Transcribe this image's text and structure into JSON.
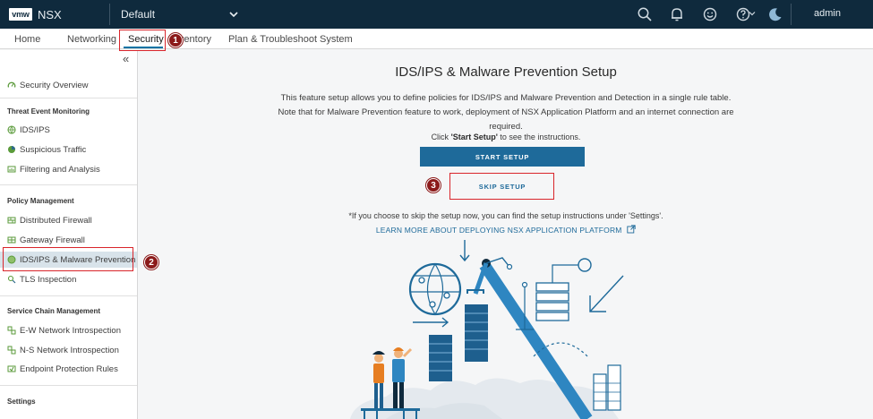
{
  "header": {
    "logo": "vmw",
    "app_name": "NSX",
    "project": "Default",
    "user": "admin"
  },
  "nav": {
    "items": [
      "Home",
      "Networking",
      "Security",
      "Inventory",
      "Plan & Troubleshoot",
      "System"
    ],
    "active": "Security"
  },
  "sidebar": {
    "collapse_glyph": "«",
    "overview": "Security Overview",
    "sections": [
      {
        "title": "Threat Event Monitoring",
        "items": [
          "IDS/IPS",
          "Suspicious Traffic",
          "Filtering and Analysis"
        ]
      },
      {
        "title": "Policy Management",
        "items": [
          "Distributed Firewall",
          "Gateway Firewall",
          "IDS/IPS & Malware Prevention",
          "TLS Inspection"
        ]
      },
      {
        "title": "Service Chain Management",
        "items": [
          "E-W Network Introspection",
          "N-S Network Introspection",
          "Endpoint Protection Rules"
        ]
      },
      {
        "title": "Settings",
        "items": []
      }
    ],
    "active_item": "IDS/IPS & Malware Prevention"
  },
  "main": {
    "title": "IDS/IPS & Malware Prevention Setup",
    "description": "This feature setup allows you to define policies for IDS/IPS and Malware Prevention and Detection in a single rule table. Note that for Malware Prevention feature to work, deployment of NSX Application Platform and an internet connection are required.",
    "instruction_prefix": "Click ",
    "instruction_bold": "'Start Setup'",
    "instruction_suffix": " to see the instructions.",
    "start_button": "START SETUP",
    "skip_button": "SKIP SETUP",
    "skip_note": "*If you choose to skip the setup now, you can find the setup instructions under 'Settings'.",
    "learn_link": "LEARN MORE ABOUT DEPLOYING NSX APPLICATION PLATFORM"
  },
  "callouts": [
    "1",
    "2",
    "3"
  ],
  "colors": {
    "header_bg": "#0f2a3d",
    "primary": "#1e6a9a",
    "highlight": "#d9252b",
    "badge": "#8b1a1a",
    "active_row": "#d8e3ea"
  }
}
